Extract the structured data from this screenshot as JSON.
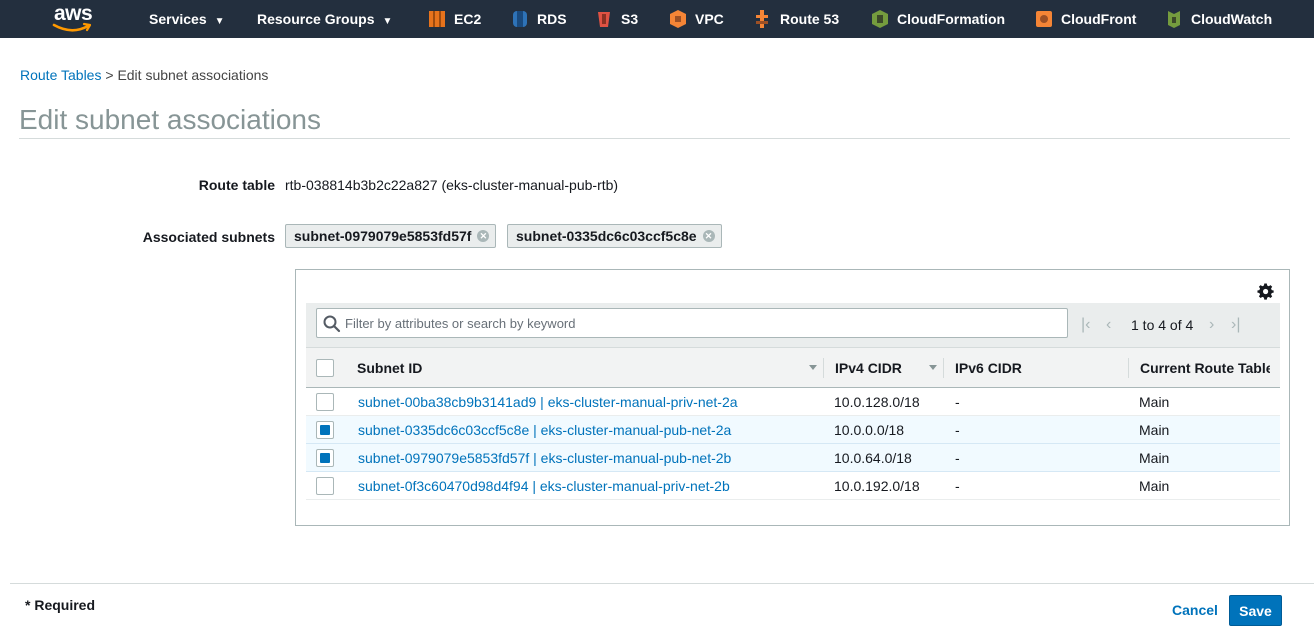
{
  "nav": {
    "logo_text": "aws",
    "services_label": "Services",
    "resource_groups_label": "Resource Groups",
    "shortcuts": [
      {
        "label": "EC2",
        "icon": "ec2-icon",
        "color": "#e7731c"
      },
      {
        "label": "RDS",
        "icon": "rds-icon",
        "color": "#2e73b8"
      },
      {
        "label": "S3",
        "icon": "s3-icon",
        "color": "#e05243"
      },
      {
        "label": "VPC",
        "icon": "vpc-icon",
        "color": "#f58536"
      },
      {
        "label": "Route 53",
        "icon": "route53-icon",
        "color": "#f58536"
      },
      {
        "label": "CloudFormation",
        "icon": "cloudformation-icon",
        "color": "#759c3e"
      },
      {
        "label": "CloudFront",
        "icon": "cloudfront-icon",
        "color": "#f58536"
      },
      {
        "label": "CloudWatch",
        "icon": "cloudwatch-icon",
        "color": "#759c3e"
      }
    ]
  },
  "breadcrumb": {
    "parent": "Route Tables",
    "separator": ">",
    "current": "Edit subnet associations"
  },
  "page_title": "Edit subnet associations",
  "form": {
    "route_table_label": "Route table",
    "route_table_value": "rtb-038814b3b2c22a827 (eks-cluster-manual-pub-rtb)",
    "associated_subnets_label": "Associated subnets",
    "associated_subnets": [
      "subnet-0979079e5853fd57f",
      "subnet-0335dc6c03ccf5c8e"
    ]
  },
  "table": {
    "search_placeholder": "Filter by attributes or search by keyword",
    "pagination": "1 to 4 of 4",
    "columns": [
      "Subnet ID",
      "IPv4 CIDR",
      "IPv6 CIDR",
      "Current Route Table"
    ],
    "rows": [
      {
        "subnet": "subnet-00ba38cb9b3141ad9 | eks-cluster-manual-priv-net-2a",
        "ipv4": "10.0.128.0/18",
        "ipv6": "-",
        "route_table": "Main",
        "checked": false
      },
      {
        "subnet": "subnet-0335dc6c03ccf5c8e | eks-cluster-manual-pub-net-2a",
        "ipv4": "10.0.0.0/18",
        "ipv6": "-",
        "route_table": "Main",
        "checked": true
      },
      {
        "subnet": "subnet-0979079e5853fd57f | eks-cluster-manual-pub-net-2b",
        "ipv4": "10.0.64.0/18",
        "ipv6": "-",
        "route_table": "Main",
        "checked": true
      },
      {
        "subnet": "subnet-0f3c60470d98d4f94 | eks-cluster-manual-priv-net-2b",
        "ipv4": "10.0.192.0/18",
        "ipv6": "-",
        "route_table": "Main",
        "checked": false
      }
    ]
  },
  "footer": {
    "required_note": "* Required",
    "cancel_label": "Cancel",
    "save_label": "Save"
  },
  "colors": {
    "nav_bg": "#232f3e",
    "link": "#0073bb",
    "primary": "#0073bb"
  }
}
